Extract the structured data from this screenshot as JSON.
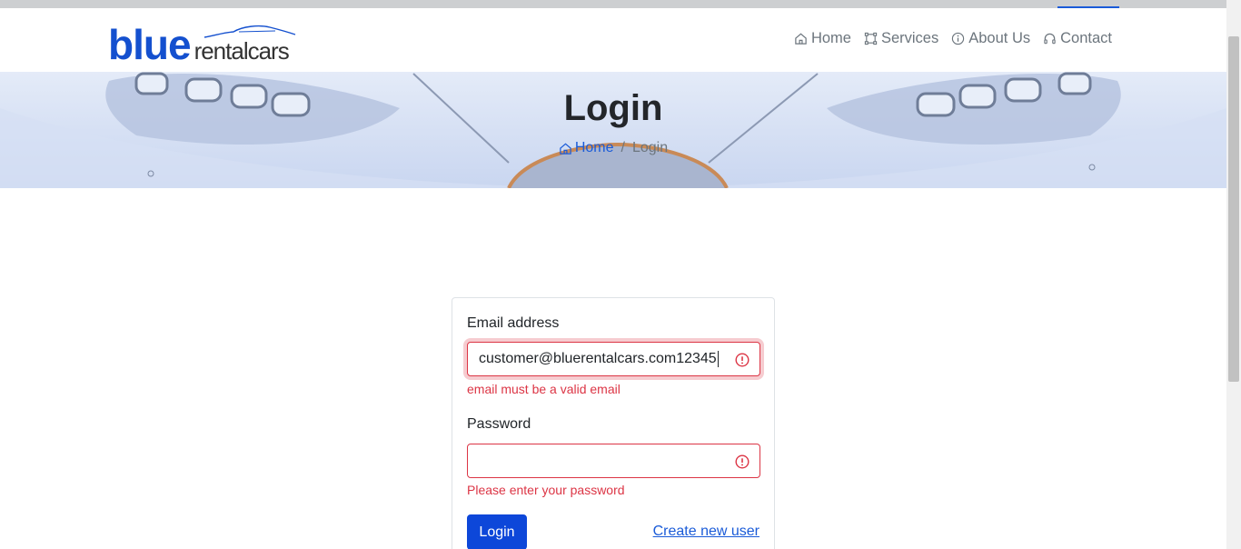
{
  "brand": {
    "logo_primary": "blue",
    "logo_secondary": "rentalcars",
    "color": "#1450cf"
  },
  "nav": {
    "items": [
      {
        "label": "Home",
        "icon": "home-icon"
      },
      {
        "label": "Services",
        "icon": "services-icon"
      },
      {
        "label": "About Us",
        "icon": "info-icon"
      },
      {
        "label": "Contact",
        "icon": "headset-icon"
      }
    ]
  },
  "hero": {
    "title": "Login",
    "breadcrumb": {
      "home": "Home",
      "separator": "/",
      "current": "Login"
    }
  },
  "form": {
    "email": {
      "label": "Email address",
      "value": "customer@bluerentalcars.com12345",
      "error": "email must be a valid email"
    },
    "password": {
      "label": "Password",
      "value": "",
      "error": "Please enter your password"
    },
    "submit_label": "Login",
    "create_link": "Create new user"
  },
  "colors": {
    "primary": "#0d47d9",
    "link": "#1a5bd8",
    "error": "#dc3545"
  }
}
